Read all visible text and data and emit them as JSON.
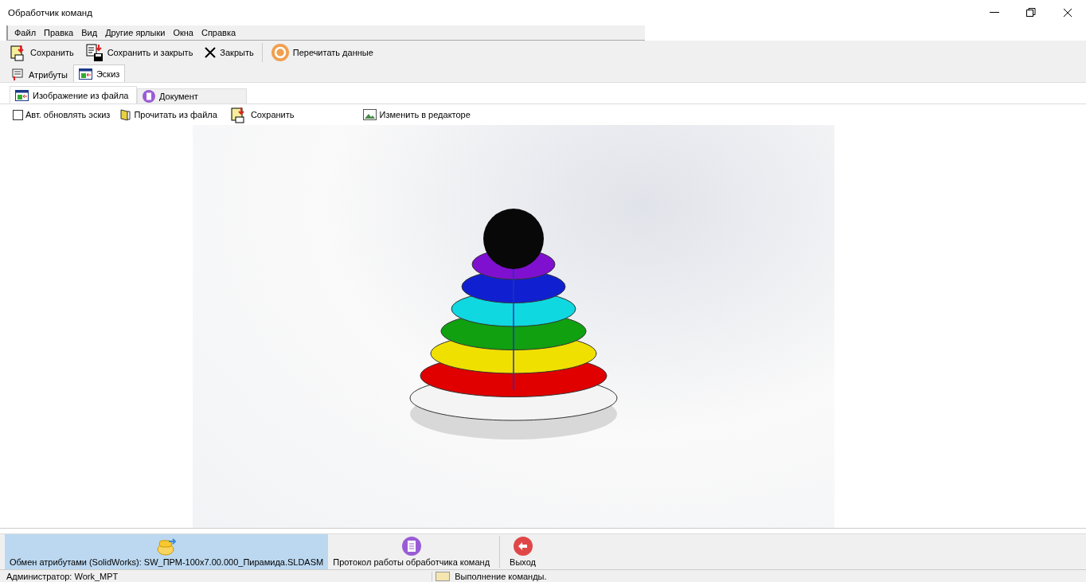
{
  "window": {
    "title": "Обработчик команд"
  },
  "menu": [
    "Файл",
    "Правка",
    "Вид",
    "Другие ярлыки",
    "Окна",
    "Справка"
  ],
  "toolbar": [
    {
      "label": "Сохранить",
      "kind": "save"
    },
    {
      "label": "Сохранить и закрыть",
      "kind": "save-close"
    },
    {
      "label": "Закрыть",
      "kind": "close"
    },
    {
      "label": "Перечитать данные",
      "kind": "reload"
    }
  ],
  "tabs": [
    {
      "label": "Атрибуты",
      "selected": false,
      "kind": "attributes"
    },
    {
      "label": "Эскиз",
      "selected": true,
      "kind": "sketch"
    }
  ],
  "subtabs": [
    {
      "label": "Изображение из файла",
      "selected": true,
      "kind": "sketch"
    },
    {
      "label": "Документ",
      "selected": false,
      "kind": "document"
    }
  ],
  "sketch_toolbar": {
    "auto_update": {
      "label": "Авт. обновлять эскиз",
      "checked": false
    },
    "buttons": [
      {
        "label": "Прочитать из файла",
        "kind": "read"
      },
      {
        "label": "Сохранить",
        "kind": "save"
      },
      {
        "label": "Изменить в редакторе",
        "kind": "edit"
      }
    ]
  },
  "taskbar": [
    {
      "label": "Обмен атрибутами (SolidWorks): SW_ПРМ-100x7.00.000_Пирамида.SLDASM",
      "selected": true,
      "kind": "exchange"
    },
    {
      "label": "Протокол работы обработчика команд",
      "selected": false,
      "kind": "log"
    },
    {
      "label": "Выход",
      "selected": false,
      "kind": "exit"
    }
  ],
  "status_bar": {
    "user": "Администратор: Work_MPT",
    "message": "Выполнение команды."
  }
}
